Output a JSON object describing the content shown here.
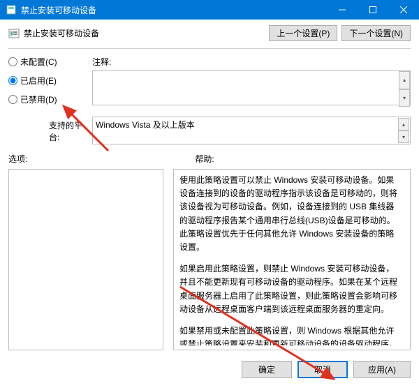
{
  "titlebar": {
    "title": "禁止安装可移动设备"
  },
  "page_title": "禁止安装可移动设备",
  "nav": {
    "prev": "上一个设置(P)",
    "next": "下一个设置(N)"
  },
  "radios": {
    "unconfigured": "未配置(C)",
    "enabled": "已启用(E)",
    "disabled": "已禁用(D)",
    "selected": "enabled"
  },
  "labels": {
    "note": "注释:",
    "platform": "支持的平台:",
    "options": "选项:",
    "help": "帮助:"
  },
  "platform_text": "Windows Vista 及以上版本",
  "help_paragraphs": [
    "使用此策略设置可以禁止 Windows 安装可移动设备。如果设备连接到的设备的驱动程序指示该设备是可移动的，则将该设备视为可移动设备。例如，设备连接到的 USB 集线器的驱动程序报告某个通用串行总线(USB)设备是可移动的。此策略设置优先于任何其他允许 Windows 安装设备的策略设置。",
    "如果启用此策略设置，则禁止 Windows 安装可移动设备，并且不能更新现有可移动设备的驱动程序。如果在某个远程桌面服务器上启用了此策略设置，则此策略设置会影响可移动设备从远程桌面客户端到该远程桌面服务器的重定向。",
    "如果禁用或未配置此策略设置，则 Windows 根据其他允许或禁止策略设置来安装和更新可移动设备的设备驱动程序。"
  ],
  "footer": {
    "ok": "确定",
    "cancel": "取消",
    "apply": "应用(A)"
  }
}
